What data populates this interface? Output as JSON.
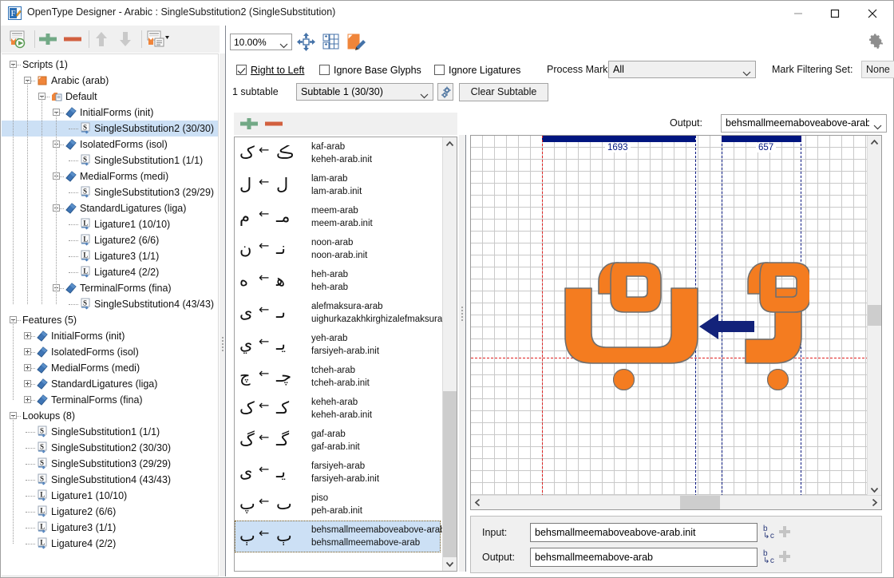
{
  "window": {
    "title": "OpenType Designer - Arabic : SingleSubstitution2 (SingleSubstitution)",
    "minimize_label": "Minimize",
    "maximize_label": "Maximize",
    "close_label": "Close"
  },
  "left_toolbar": {
    "items": [
      {
        "name": "preview-lookup-icon",
        "tip": "Preview"
      },
      {
        "name": "add-icon",
        "tip": "Add"
      },
      {
        "name": "remove-icon",
        "tip": "Remove"
      },
      {
        "name": "move-up-icon",
        "tip": "Move Up"
      },
      {
        "name": "move-down-icon",
        "tip": "Move Down"
      },
      {
        "name": "report-dropdown-icon",
        "tip": "Report"
      }
    ]
  },
  "tree": {
    "nodes": [
      {
        "label": "Scripts (1)",
        "depth": 0,
        "icon": "none",
        "expander": "minus",
        "selected": false
      },
      {
        "label": "Arabic (arab)",
        "depth": 1,
        "icon": "script",
        "expander": "minus",
        "selected": false
      },
      {
        "label": "Default",
        "depth": 2,
        "icon": "langsys",
        "expander": "minus",
        "selected": false
      },
      {
        "label": "InitialForms (init)",
        "depth": 3,
        "icon": "feature",
        "expander": "minus",
        "selected": false
      },
      {
        "label": "SingleSubstitution2 (30/30)",
        "depth": 4,
        "icon": "sub",
        "expander": "none",
        "selected": true
      },
      {
        "label": "IsolatedForms (isol)",
        "depth": 3,
        "icon": "feature",
        "expander": "minus",
        "selected": false
      },
      {
        "label": "SingleSubstitution1 (1/1)",
        "depth": 4,
        "icon": "sub",
        "expander": "none",
        "selected": false
      },
      {
        "label": "MedialForms (medi)",
        "depth": 3,
        "icon": "feature",
        "expander": "minus",
        "selected": false
      },
      {
        "label": "SingleSubstitution3 (29/29)",
        "depth": 4,
        "icon": "sub",
        "expander": "none",
        "selected": false
      },
      {
        "label": "StandardLigatures (liga)",
        "depth": 3,
        "icon": "feature",
        "expander": "minus",
        "selected": false
      },
      {
        "label": "Ligature1 (10/10)",
        "depth": 4,
        "icon": "lig",
        "expander": "none",
        "selected": false
      },
      {
        "label": "Ligature2 (6/6)",
        "depth": 4,
        "icon": "lig",
        "expander": "none",
        "selected": false
      },
      {
        "label": "Ligature3 (1/1)",
        "depth": 4,
        "icon": "lig",
        "expander": "none",
        "selected": false
      },
      {
        "label": "Ligature4 (2/2)",
        "depth": 4,
        "icon": "lig",
        "expander": "none",
        "selected": false
      },
      {
        "label": "TerminalForms (fina)",
        "depth": 3,
        "icon": "feature",
        "expander": "minus",
        "selected": false
      },
      {
        "label": "SingleSubstitution4 (43/43)",
        "depth": 4,
        "icon": "sub",
        "expander": "none",
        "selected": false
      },
      {
        "label": "Features (5)",
        "depth": 0,
        "icon": "none",
        "expander": "minus",
        "selected": false
      },
      {
        "label": "InitialForms (init)",
        "depth": 1,
        "icon": "feature",
        "expander": "plus",
        "selected": false
      },
      {
        "label": "IsolatedForms (isol)",
        "depth": 1,
        "icon": "feature",
        "expander": "plus",
        "selected": false
      },
      {
        "label": "MedialForms (medi)",
        "depth": 1,
        "icon": "feature",
        "expander": "plus",
        "selected": false
      },
      {
        "label": "StandardLigatures (liga)",
        "depth": 1,
        "icon": "feature",
        "expander": "plus",
        "selected": false
      },
      {
        "label": "TerminalForms (fina)",
        "depth": 1,
        "icon": "feature",
        "expander": "plus",
        "selected": false
      },
      {
        "label": "Lookups (8)",
        "depth": 0,
        "icon": "none",
        "expander": "minus",
        "selected": false
      },
      {
        "label": "SingleSubstitution1 (1/1)",
        "depth": 1,
        "icon": "sub",
        "expander": "none",
        "selected": false
      },
      {
        "label": "SingleSubstitution2 (30/30)",
        "depth": 1,
        "icon": "sub",
        "expander": "none",
        "selected": false
      },
      {
        "label": "SingleSubstitution3 (29/29)",
        "depth": 1,
        "icon": "sub",
        "expander": "none",
        "selected": false
      },
      {
        "label": "SingleSubstitution4 (43/43)",
        "depth": 1,
        "icon": "sub",
        "expander": "none",
        "selected": false
      },
      {
        "label": "Ligature1 (10/10)",
        "depth": 1,
        "icon": "lig",
        "expander": "none",
        "selected": false
      },
      {
        "label": "Ligature2 (6/6)",
        "depth": 1,
        "icon": "lig",
        "expander": "none",
        "selected": false
      },
      {
        "label": "Ligature3 (1/1)",
        "depth": 1,
        "icon": "lig",
        "expander": "none",
        "selected": false
      },
      {
        "label": "Ligature4 (2/2)",
        "depth": 1,
        "icon": "lig",
        "expander": "none",
        "selected": false
      }
    ]
  },
  "toolbar": {
    "zoom_value": "10.00%",
    "fit_icon": "fit-to-window-icon",
    "grid_icon": "glyph-grid-icon",
    "edit_icon": "edit-glyph-icon",
    "settings_icon": "gear-icon"
  },
  "options": {
    "right_to_left_label": "Right to Left",
    "right_to_left_checked": true,
    "ignore_base_glyphs_label": "Ignore Base Glyphs",
    "ignore_base_glyphs_checked": false,
    "ignore_ligatures_label": "Ignore Ligatures",
    "ignore_ligatures_checked": false,
    "process_marks_label": "Process Marks:",
    "process_marks_value": "All",
    "mark_filtering_set_label": "Mark Filtering Set:",
    "mark_filtering_set_value": "None",
    "subtable_count_label": "1 subtable",
    "subtable_value": "Subtable 1 (30/30)",
    "subtable_settings_icon": "gears-icon",
    "clear_subtable_label": "Clear Subtable"
  },
  "glyph_list": {
    "add_label": "add-icon",
    "remove_label": "remove-icon",
    "rows": [
      {
        "preview_to": "ک",
        "preview_from": "ڪ",
        "input": "kaf-arab",
        "output": "keheh-arab.init",
        "selected": false
      },
      {
        "preview_to": "ل",
        "preview_from": "ل",
        "input": "lam-arab",
        "output": "lam-arab.init",
        "selected": false
      },
      {
        "preview_to": "م",
        "preview_from": "مـ",
        "input": "meem-arab",
        "output": "meem-arab.init",
        "selected": false
      },
      {
        "preview_to": "ن",
        "preview_from": "نـ",
        "input": "noon-arab",
        "output": "noon-arab.init",
        "selected": false
      },
      {
        "preview_to": "ه",
        "preview_from": "ﻫ",
        "input": "heh-arab",
        "output": "heh-arab",
        "selected": false
      },
      {
        "preview_to": "ى",
        "preview_from": "ىـ",
        "input": "alefmaksura-arab",
        "output": "uighurkazakhkirghizalefmaksura-arab.ini",
        "selected": false
      },
      {
        "preview_to": "ي",
        "preview_from": "يـ",
        "input": "yeh-arab",
        "output": "farsiyeh-arab.init",
        "selected": false
      },
      {
        "preview_to": "چ",
        "preview_from": "چـ",
        "input": "tcheh-arab",
        "output": "tcheh-arab.init",
        "selected": false
      },
      {
        "preview_to": "ک",
        "preview_from": "کـ",
        "input": "keheh-arab",
        "output": "keheh-arab.init",
        "selected": false
      },
      {
        "preview_to": "گ",
        "preview_from": "گـ",
        "input": "gaf-arab",
        "output": "gaf-arab.init",
        "selected": false
      },
      {
        "preview_to": "ی",
        "preview_from": "یـ",
        "input": "farsiyeh-arab",
        "output": "farsiyeh-arab.init",
        "selected": false
      },
      {
        "preview_to": "پ",
        "preview_from": "ٮ",
        "input": "piso",
        "output": "peh-arab.init",
        "selected": false
      },
      {
        "preview_to": "ٻ",
        "preview_from": "ٻ",
        "input": "behsmallmeemaboveabove-arab.init",
        "output": "behsmallmeemabove-arab",
        "selected": true
      }
    ]
  },
  "canvas": {
    "output_label": "Output:",
    "output_value": "behsmallmeemaboveabove-arab.i",
    "advance_left": "1693",
    "advance_right": "657",
    "arrow_icon": "substitution-arrow-icon",
    "glyph_color": "#F47C20",
    "guide_color": "#00157f",
    "baseline_color": "#e02020"
  },
  "io": {
    "input_label": "Input:",
    "input_value": "behsmallmeemaboveabove-arab.init",
    "output_label": "Output:",
    "output_value": "behsmallmeemabove-arab",
    "input_pick_icon": "glyph-picker-icon",
    "input_add_icon": "add-icon",
    "output_pick_icon": "glyph-picker-icon",
    "output_add_icon": "add-icon"
  }
}
